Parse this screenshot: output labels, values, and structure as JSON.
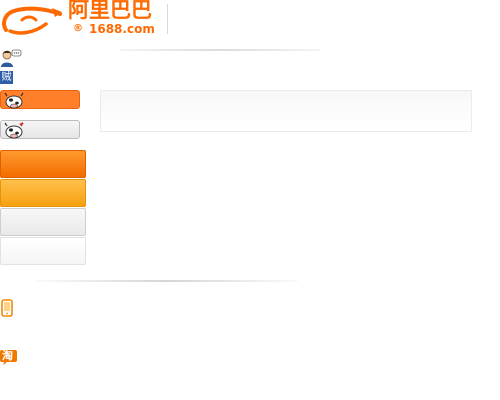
{
  "logo": {
    "name_cn": "阿里巴巴",
    "registered": "®",
    "domain": "1688.com"
  },
  "icons": {
    "user": "user-chat-icon",
    "language": "chinese-char-icon",
    "language_glyph": "贼",
    "tab_mascot": "cow-mascot-icon",
    "mobile": "mobile-phone-icon",
    "taobao": "taobao-icon",
    "taobao_glyph": "淘"
  },
  "colors": {
    "brand_orange": "#ff6a00",
    "tab_active": "#ff7f2a",
    "bar_orange": "#f26c00",
    "bar_yellow": "#f5a10f",
    "icon_blue": "#2d5ea8"
  }
}
